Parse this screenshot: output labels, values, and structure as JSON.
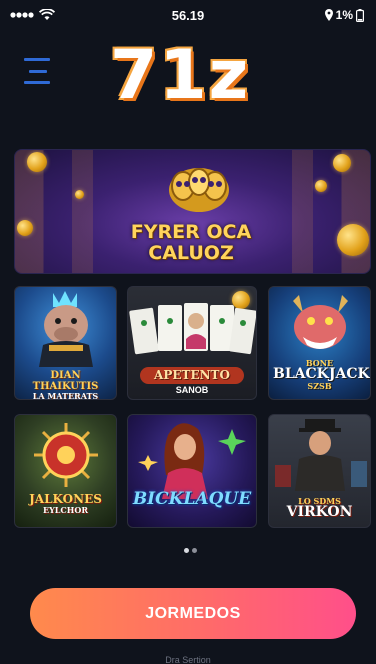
{
  "status_bar": {
    "time": "56.19",
    "battery": "1%"
  },
  "header": {
    "logo": "71z",
    "menu_icon": "hamburger-menu-icon"
  },
  "banner": {
    "title_line1": "FYRER OCA",
    "title_line2": "CALUOZ"
  },
  "games": [
    {
      "caption": "DIAN THAIKUTIS",
      "sub": "LA MATERATS"
    },
    {
      "caption": "APETENTO",
      "sub": "SANOB"
    },
    {
      "caption": "BLACKJACK",
      "sub": "BONE",
      "sub2": "SZSB"
    },
    {
      "caption": "JALKONES",
      "sub": "EYLCHOR"
    },
    {
      "caption": "BICKLAQUE",
      "sub": ""
    },
    {
      "caption": "VIRKON",
      "sub": "LO SDMS"
    }
  ],
  "pager": {
    "active_page": 1,
    "pages": 3
  },
  "cta": {
    "label": "JORMEDOS"
  },
  "footer": {
    "label": "Dra Sertion"
  },
  "colors": {
    "background": "#0f131c",
    "menu": "#2f6ad6",
    "cta_start": "#ff8a4c",
    "cta_end": "#ff4f8a",
    "logo_outline": "#e8761a"
  }
}
